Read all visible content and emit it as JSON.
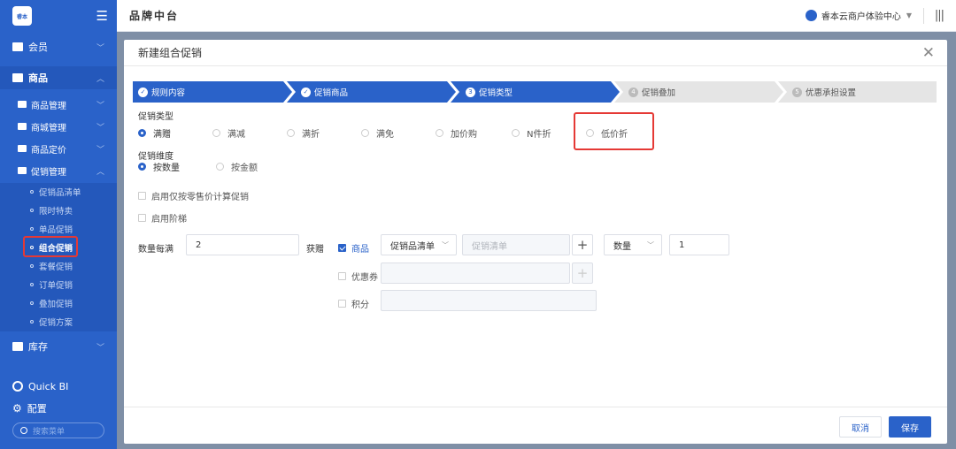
{
  "sidebar": {
    "logo_text": "睿本",
    "menu_icon": "hamburger-icon",
    "items": [
      {
        "label": "会员"
      },
      {
        "label": "商品"
      },
      {
        "label": "库存"
      }
    ],
    "sub_items": [
      {
        "label": "商品管理"
      },
      {
        "label": "商城管理"
      },
      {
        "label": "商品定价"
      },
      {
        "label": "促销管理"
      }
    ],
    "leaf_items": [
      {
        "label": "促销品清单"
      },
      {
        "label": "限时特卖"
      },
      {
        "label": "单品促销"
      },
      {
        "label": "组合促销"
      },
      {
        "label": "套餐促销"
      },
      {
        "label": "订单促销"
      },
      {
        "label": "叠加促销"
      },
      {
        "label": "促销方案"
      }
    ],
    "quick_bi": "Quick BI",
    "config": "配置",
    "search_placeholder": "搜索菜单"
  },
  "topbar": {
    "title": "品牌中台",
    "org": "睿本云商户体验中心"
  },
  "modal": {
    "title": "新建组合促销",
    "steps": [
      {
        "num": "✓",
        "label": "规则内容"
      },
      {
        "num": "✓",
        "label": "促销商品"
      },
      {
        "num": "3",
        "label": "促销类型"
      },
      {
        "num": "4",
        "label": "促销叠加"
      },
      {
        "num": "5",
        "label": "优惠承担设置"
      }
    ],
    "promo_type_label": "促销类型",
    "promo_types": [
      "满赠",
      "满减",
      "满折",
      "满免",
      "加价购",
      "N件折",
      "低价折"
    ],
    "dimension_label": "促销维度",
    "dimensions": [
      "按数量",
      "按金额"
    ],
    "option_retail_price": "启用仅按零售价计算促销",
    "option_tier": "启用阶梯",
    "qty_label": "数量每满",
    "qty_value": "2",
    "gift_label": "获赠",
    "gift_goods": "商品",
    "gift_list_select": "促销品清单",
    "gift_list_placeholder": "促销清单",
    "gift_qty_select": "数量",
    "gift_qty_value": "1",
    "gift_coupon": "优惠券",
    "gift_points": "积分",
    "cancel": "取消",
    "save": "保存"
  },
  "colors": {
    "primary": "#2a62c9",
    "highlight": "#e53935"
  }
}
